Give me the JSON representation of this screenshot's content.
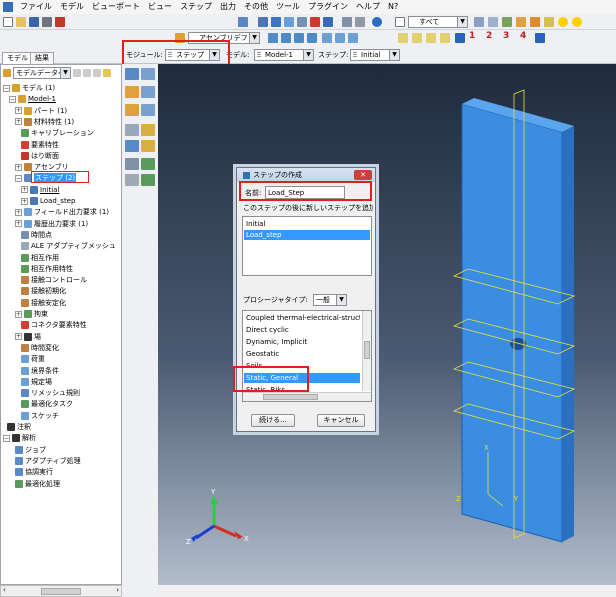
{
  "menu": [
    "ファイル",
    "モデル",
    "ビューポート",
    "ビュー",
    "ステップ",
    "出力",
    "その他",
    "ツール",
    "プラグイン",
    "ヘルプ",
    "N?"
  ],
  "toolbar": {
    "assembly_default": "アセンブリデフォルト",
    "selection_filter": "すべて",
    "view_numbers": [
      "1",
      "2",
      "3",
      "4"
    ]
  },
  "context": {
    "module_label": "モジュール:",
    "module_value": "ステップ",
    "model_label": "モデル:",
    "model_value": "Model-1",
    "step_label": "ステップ:",
    "step_value": "Initial"
  },
  "tabs": [
    "モデル",
    "結果"
  ],
  "tree": {
    "header": "モデルデータベ",
    "items": [
      "モデル (1)",
      "Model-1",
      "パート (1)",
      "材料特性 (1)",
      "キャリブレーション",
      "要素特性",
      "はり断面",
      "アセンブリ",
      "ステップ (2)",
      "Initial",
      "Load_step",
      "フィールド出力要求 (1)",
      "履歴出力要求 (1)",
      "時間点",
      "ALE アダプティブメッシュ",
      "相互作用",
      "相互作用特性",
      "接触コントロール",
      "接触初期化",
      "接触安定化",
      "拘束",
      "コネクタ要素特性",
      "場",
      "時間変化",
      "荷重",
      "境界条件",
      "規定場",
      "リメッシュ規則",
      "最適化タスク",
      "スケッチ",
      "注釈",
      "解析",
      "ジョブ",
      "アダプティブ処理",
      "協調実行",
      "最適化処理"
    ]
  },
  "dialog": {
    "title": "ステップの作成",
    "close": "✕",
    "name_label": "名前:",
    "name_value": "Load_Step",
    "insert_label": "このステップの後に新しいステップを追加",
    "steps": [
      "Initial",
      "Load_step"
    ],
    "procedure_label": "プロシージャタイプ:",
    "procedure_value": "一般",
    "procedures": [
      "Coupled thermal-electrical-structural",
      "Direct cyclic",
      "Dynamic, Implicit",
      "Geostatic",
      "Soils",
      "Static, General",
      "Static, Riks"
    ],
    "continue": "続ける...",
    "cancel": "キャンセル"
  },
  "viewport": {
    "axis_x": "X",
    "axis_y": "Y",
    "axis_z": "Z",
    "part_color": "#3a8de0"
  }
}
